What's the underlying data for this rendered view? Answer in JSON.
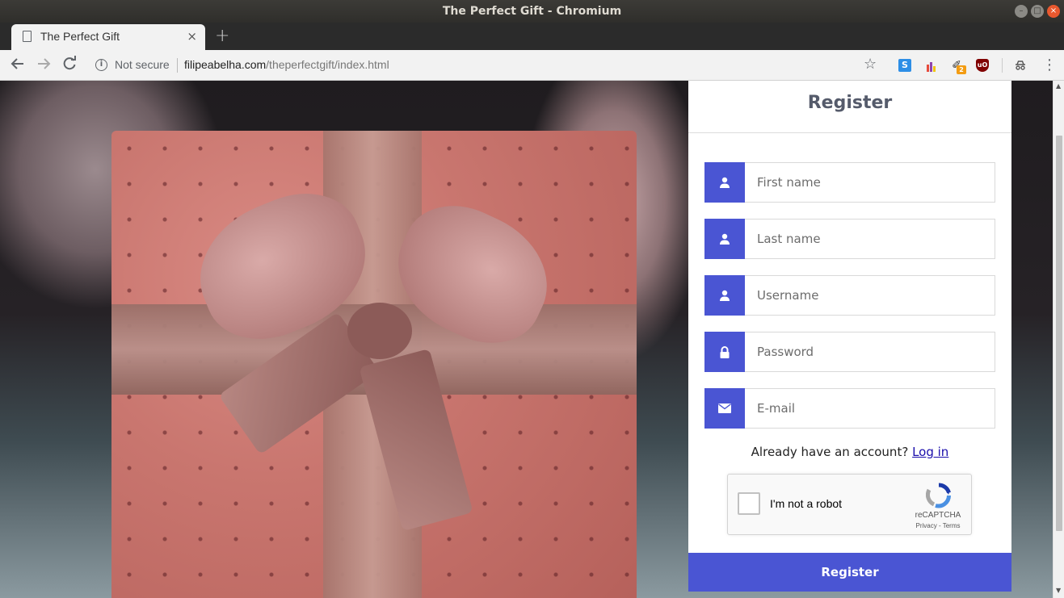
{
  "window": {
    "title": "The Perfect Gift - Chromium"
  },
  "tab": {
    "title": "The Perfect Gift",
    "close_symbol": "×",
    "new_tab_symbol": "+"
  },
  "toolbar": {
    "not_secure": "Not secure",
    "url_host": "filipeabelha.com",
    "url_path": "/theperfectgift/index.html",
    "extension_badge": "2",
    "extension_s_label": "S",
    "extension_ublock_label": "uO"
  },
  "register": {
    "title": "Register",
    "fields": [
      {
        "placeholder": "First name",
        "icon": "user-icon"
      },
      {
        "placeholder": "Last name",
        "icon": "user-icon"
      },
      {
        "placeholder": "Username",
        "icon": "user-icon"
      },
      {
        "placeholder": "Password",
        "icon": "lock-icon"
      },
      {
        "placeholder": "E-mail",
        "icon": "envelope-icon"
      }
    ],
    "already_text": "Already have an account?",
    "login_link": "Log in",
    "submit_label": "Register"
  },
  "captcha": {
    "label": "I'm not a robot",
    "brand": "reCAPTCHA",
    "links": "Privacy - Terms"
  },
  "colors": {
    "accent": "#4a55d3",
    "title_text": "#555b6b",
    "link": "#1a0dab"
  }
}
